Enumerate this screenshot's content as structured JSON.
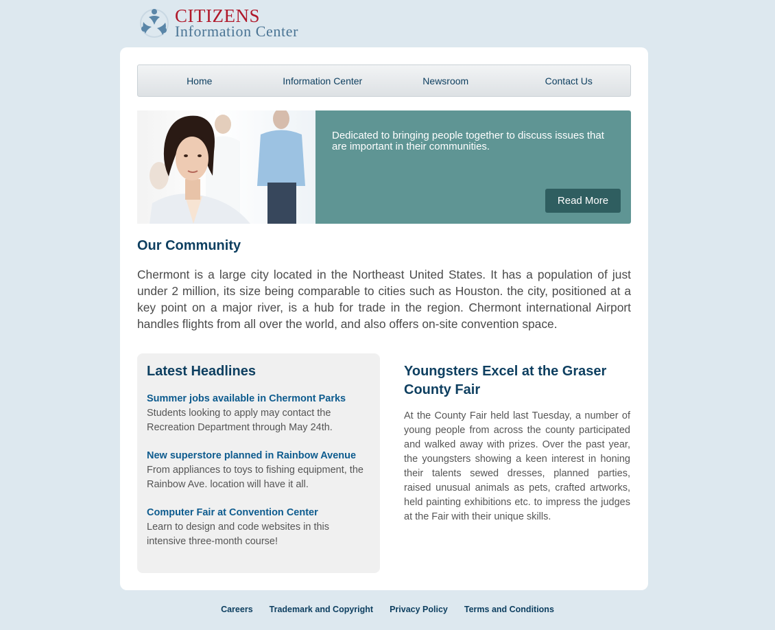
{
  "logo": {
    "line1": "CITIZENS",
    "line2": "Information Center",
    "icon": "people-circle-logo-icon"
  },
  "nav": {
    "items": [
      {
        "label": "Home"
      },
      {
        "label": "Information Center"
      },
      {
        "label": "Newsroom"
      },
      {
        "label": "Contact Us"
      }
    ]
  },
  "hero": {
    "text": "Dedicated to bringing people together to discuss issues that are important in their communities.",
    "button_label": "Read More",
    "accent_color": "#5f9594",
    "button_color": "#2f5e60"
  },
  "community": {
    "title": "Our Community",
    "text": "Chermont is a large city located in the Northeast United States. It has a population of just under 2 million, its size being comparable to cities such as Houston. the city, positioned at a key point on a major river, is a hub for trade in the region. Chermont international Airport handles flights from all over the world, and also offers on-site convention space."
  },
  "headlines": {
    "title": "Latest Headlines",
    "items": [
      {
        "title": "Summer jobs available in Chermont Parks",
        "text": "Students looking to apply may contact the Recreation Department through May 24th."
      },
      {
        "title": "New superstore planned in Rainbow Avenue",
        "text": "From appliances to toys to fishing equipment, the Rainbow Ave. location will have it all."
      },
      {
        "title": "Computer Fair at Convention Center",
        "text": "Learn to design and code websites in this intensive three-month course!"
      }
    ]
  },
  "feature": {
    "title": "Youngsters Excel at the Graser County Fair",
    "text": "At the County Fair held last Tuesday, a number of young people from across the county participated and walked away with prizes. Over the past year, the youngsters showing a keen interest in honing their talents sewed dresses, planned parties, raised unusual animals as pets, crafted artworks, held painting exhibitions etc. to impress the judges at the Fair with their unique skills."
  },
  "footer": {
    "links": [
      {
        "label": "Careers"
      },
      {
        "label": "Trademark and Copyright"
      },
      {
        "label": "Privacy Policy"
      },
      {
        "label": "Terms and Conditions"
      }
    ]
  },
  "colors": {
    "page_bg": "#dde8ef",
    "heading": "#0e3f60",
    "link": "#0d5b8e",
    "brand_red": "#b0182a"
  }
}
